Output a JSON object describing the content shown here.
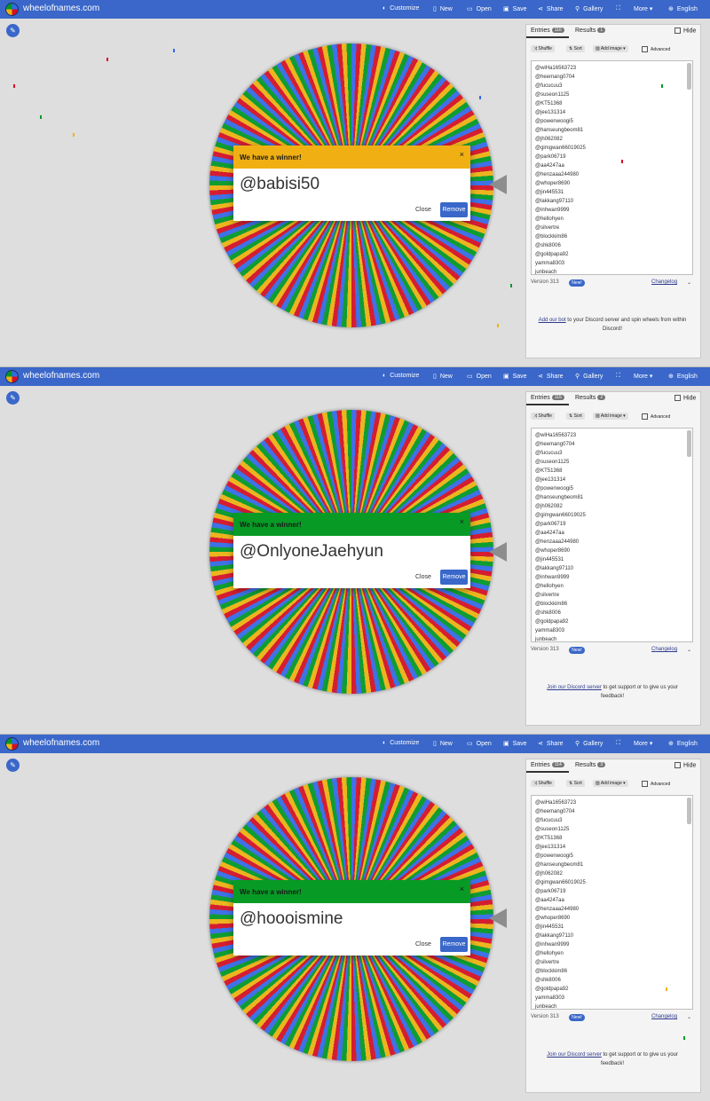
{
  "topbar": {
    "brand": "wheelofnames.com",
    "customize": "Customize",
    "new": "New",
    "open": "Open",
    "save": "Save",
    "share": "Share",
    "gallery": "Gallery",
    "more": "More",
    "language": "English"
  },
  "icons": {
    "customize": "palette-icon",
    "new": "file-icon",
    "open": "folder-icon",
    "save": "save-icon",
    "share": "share-icon",
    "gallery": "search-icon",
    "fullscreen": "fullscreen-icon",
    "language": "globe-icon",
    "edit": "pencil-icon"
  },
  "colors": {
    "brand": "#3a67c9",
    "wheel": [
      "#3369e8",
      "#d50f25",
      "#eeb211",
      "#009925"
    ],
    "header_yellow": "#f0b013",
    "header_green": "#079b25"
  },
  "sidebar": {
    "tab_entries": "Entries",
    "tab_results": "Results",
    "hide": "Hide",
    "shuffle": "Shuffle",
    "sort": "Sort",
    "add_image": "Add image",
    "advanced": "Advanced",
    "version": "Version 313",
    "new_badge": "New!",
    "changelog": "Changelog",
    "entries": [
      "@wiHa16563723",
      "@heemang0704",
      "@fucucuu3",
      "@suseon1125",
      "@KT51368",
      "@jee131314",
      "@powenwoogi5",
      "@hanseungbeom81",
      "@jh062082",
      "@gimgwan66019025",
      "@park06719",
      "@aa4247aa",
      "@henzaaa244980",
      "@whoper8690",
      "@jin445531",
      "@lakkang97110",
      "@inhwan9999",
      "@hellohyen",
      "@silvertre",
      "@blockkim86",
      "@shk8006",
      "@goldpapa92",
      "yamma8303",
      "junbeach"
    ]
  },
  "panels": [
    {
      "dialog_title": "We have a winner!",
      "winner": "@babisi50",
      "close": "Close",
      "remove": "Remove",
      "close_x": "×",
      "entries_count": "116",
      "results_count": "1",
      "note_link": "Add our bot",
      "note_text": " to your Discord server and spin wheels from within Discord!"
    },
    {
      "dialog_title": "We have a winner!",
      "winner": "@OnlyoneJaehyun",
      "close": "Close",
      "remove": "Remove",
      "close_x": "×",
      "entries_count": "115",
      "results_count": "2",
      "note_link": "Join our Discord server",
      "note_text": " to get support or to give us your feedback!"
    },
    {
      "dialog_title": "We have a winner!",
      "winner": "@hoooismine",
      "close": "Close",
      "remove": "Remove",
      "close_x": "×",
      "entries_count": "114",
      "results_count": "3",
      "note_link": "Join our Discord server",
      "note_text": " to get support or to give us your feedback!"
    }
  ]
}
